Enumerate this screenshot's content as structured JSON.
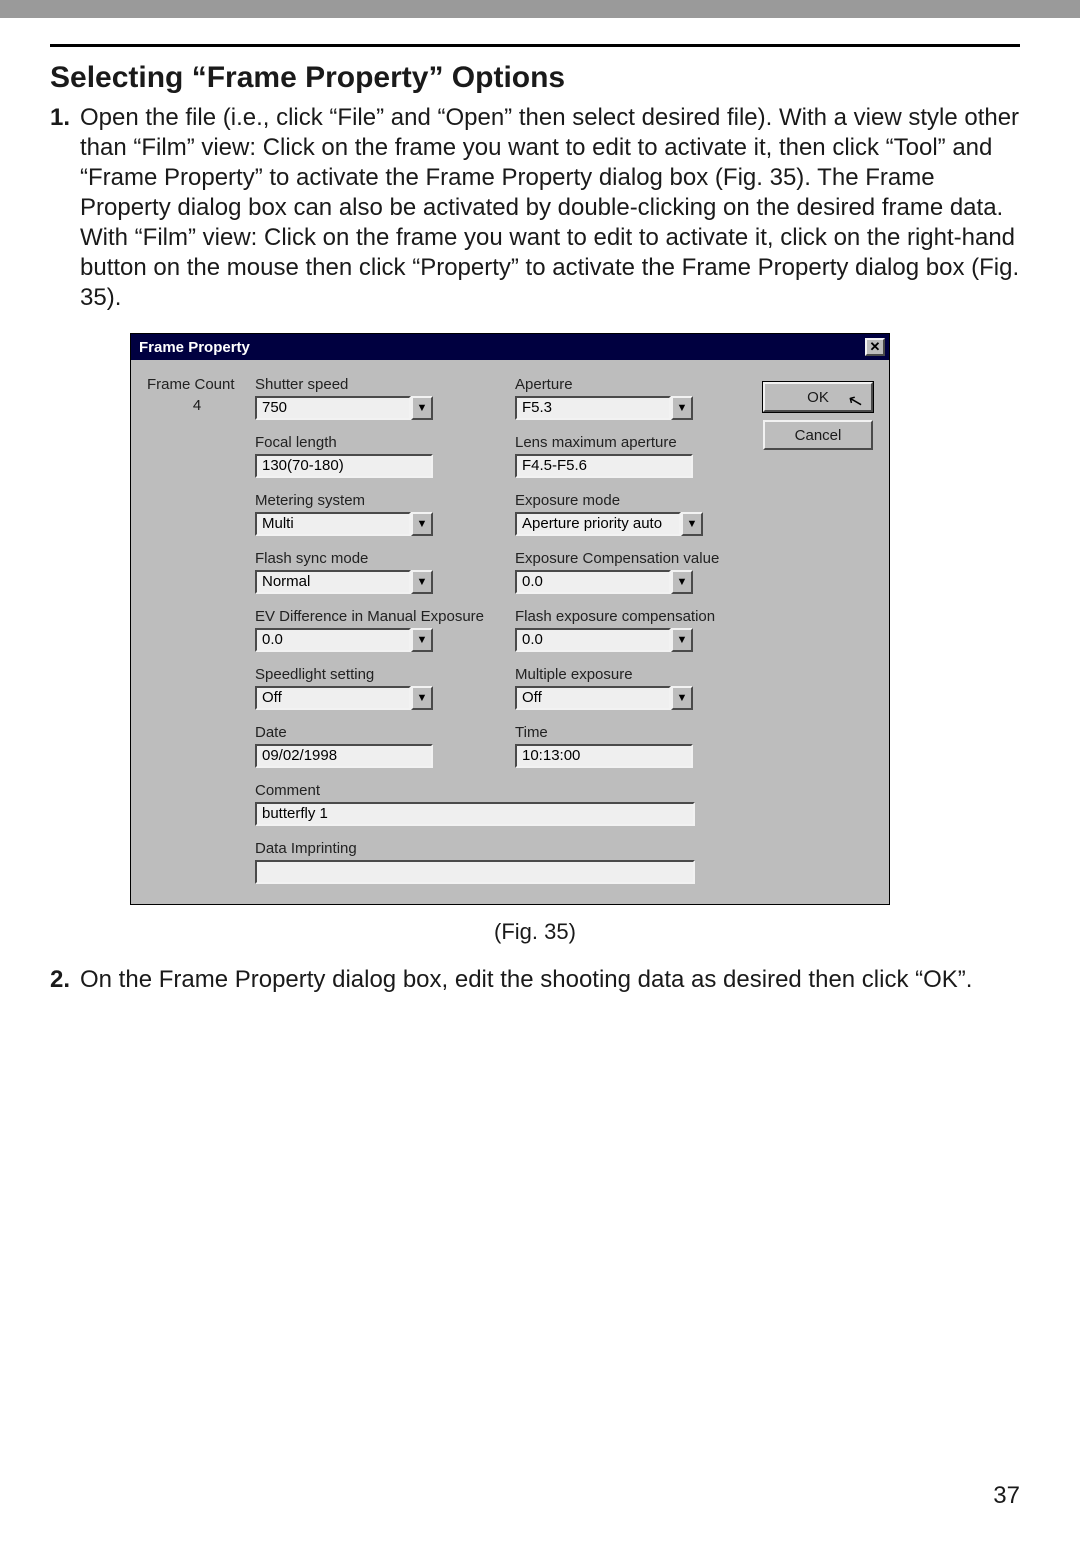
{
  "section_title": "Selecting “Frame Property” Options",
  "steps": [
    {
      "num": "1.",
      "text": "Open the file (i.e., click “File” and “Open” then select desired file). With a view style other than “Film” view: Click on the frame you want to edit to activate it, then click “Tool” and “Frame Property” to activate the Frame Property dialog box (Fig. 35). The Frame Property dialog box can also be activated by double-clicking on the desired frame data.\nWith “Film” view: Click on the frame you want to edit to activate it, click on the right-hand button on the mouse then click “Property” to activate the Frame Property dialog box (Fig. 35)."
    },
    {
      "num": "2.",
      "text": "On the Frame Property dialog box, edit the shooting data as desired then click “OK”."
    }
  ],
  "figure_caption": "(Fig. 35)",
  "page_number": "37",
  "dialog": {
    "title": "Frame Property",
    "frame_count_label": "Frame Count",
    "frame_count_value": "4",
    "buttons": {
      "ok": "OK",
      "cancel": "Cancel"
    },
    "fields": {
      "shutter_speed": {
        "label": "Shutter speed",
        "value": "750",
        "type": "combo"
      },
      "aperture": {
        "label": "Aperture",
        "value": "F5.3",
        "type": "combo"
      },
      "focal_length": {
        "label": "Focal length",
        "value": "130(70-180)",
        "type": "text"
      },
      "lens_max_ap": {
        "label": "Lens maximum aperture",
        "value": "F4.5-F5.6",
        "type": "text"
      },
      "metering": {
        "label": "Metering system",
        "value": "Multi",
        "type": "combo"
      },
      "exposure_mode": {
        "label": "Exposure mode",
        "value": "Aperture priority auto",
        "type": "combo"
      },
      "flash_sync": {
        "label": "Flash sync mode",
        "value": "Normal",
        "type": "combo"
      },
      "ev_comp": {
        "label": "Exposure Compensation value",
        "value": "0.0",
        "type": "combo"
      },
      "ev_diff": {
        "label": "EV Difference in Manual Exposure",
        "value": "0.0",
        "type": "combo"
      },
      "flash_comp": {
        "label": "Flash exposure compensation",
        "value": "0.0",
        "type": "combo"
      },
      "speedlight": {
        "label": "Speedlight setting",
        "value": "Off",
        "type": "combo"
      },
      "multi_exposure": {
        "label": "Multiple exposure",
        "value": "Off",
        "type": "combo"
      },
      "date": {
        "label": "Date",
        "value": "09/02/1998",
        "type": "text"
      },
      "time": {
        "label": "Time",
        "value": "10:13:00",
        "type": "text"
      },
      "comment": {
        "label": "Comment",
        "value": "butterfly 1",
        "type": "text"
      },
      "data_imprinting": {
        "label": "Data Imprinting",
        "value": "",
        "type": "text"
      }
    }
  }
}
